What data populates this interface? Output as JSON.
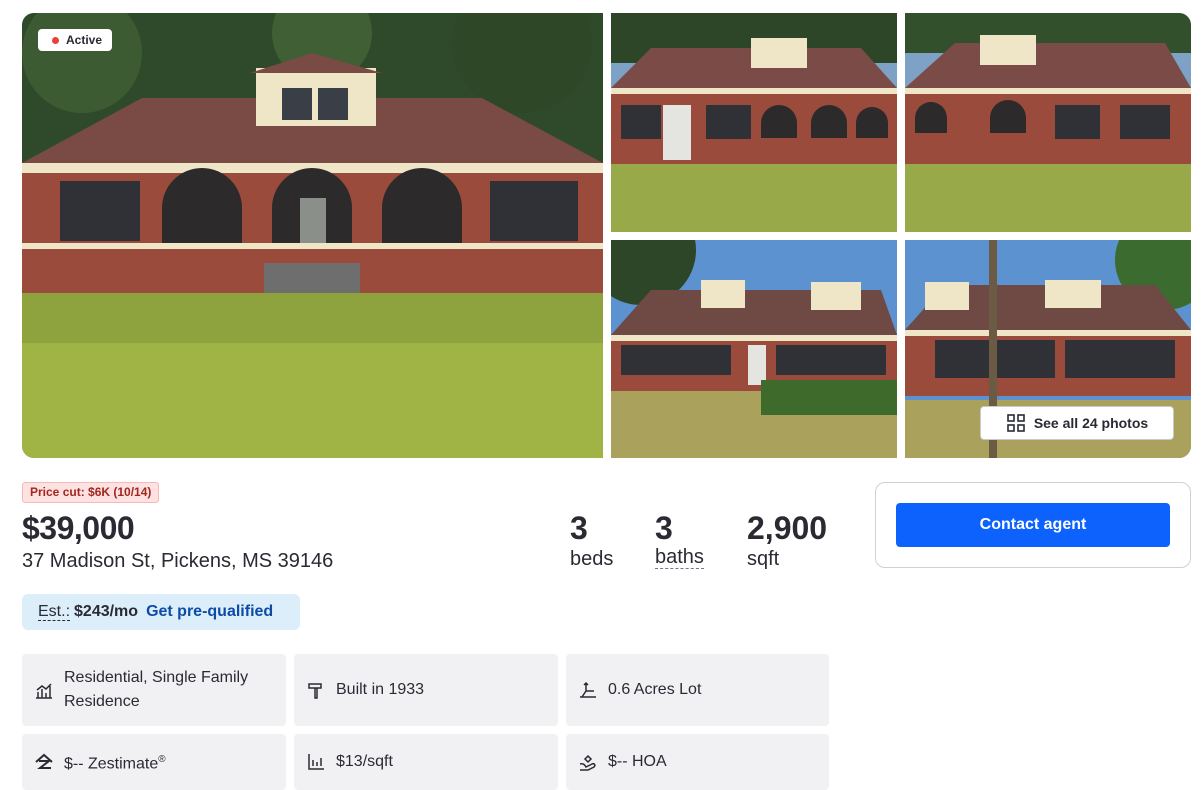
{
  "gallery": {
    "status_label": "Active",
    "see_all_label": "See all 24 photos"
  },
  "listing": {
    "price_cut": "Price cut: $6K (10/14)",
    "price": "$39,000",
    "address": "37 Madison St, Pickens, MS 39146",
    "stats": [
      {
        "value": "3",
        "label": "beds"
      },
      {
        "value": "3",
        "label": "baths"
      },
      {
        "value": "2,900",
        "label": "sqft"
      }
    ]
  },
  "contact": {
    "button_label": "Contact agent"
  },
  "estimate": {
    "label": "Est.:",
    "amount": "$243/mo",
    "link": "Get pre-qualified"
  },
  "facts": [
    {
      "icon": "building-chart-icon",
      "text": "Residential, Single Family Residence"
    },
    {
      "icon": "hammer-icon",
      "text": "Built in 1933"
    },
    {
      "icon": "lot-size-icon",
      "text": "0.6 Acres Lot"
    },
    {
      "icon": "zestimate-house-icon",
      "text": "$-- Zestimate",
      "sup": "®"
    },
    {
      "icon": "price-per-sqft-icon",
      "text": "$13/sqft"
    },
    {
      "icon": "hoa-hands-icon",
      "text": "$-- HOA"
    }
  ],
  "colors": {
    "accent": "#0d62fd",
    "link": "#0d4ca6",
    "status_dot": "#e8413c",
    "price_cut_bg": "#fde2e1",
    "estimate_bg": "#dbeefa",
    "fact_bg": "#f1f1f4"
  }
}
